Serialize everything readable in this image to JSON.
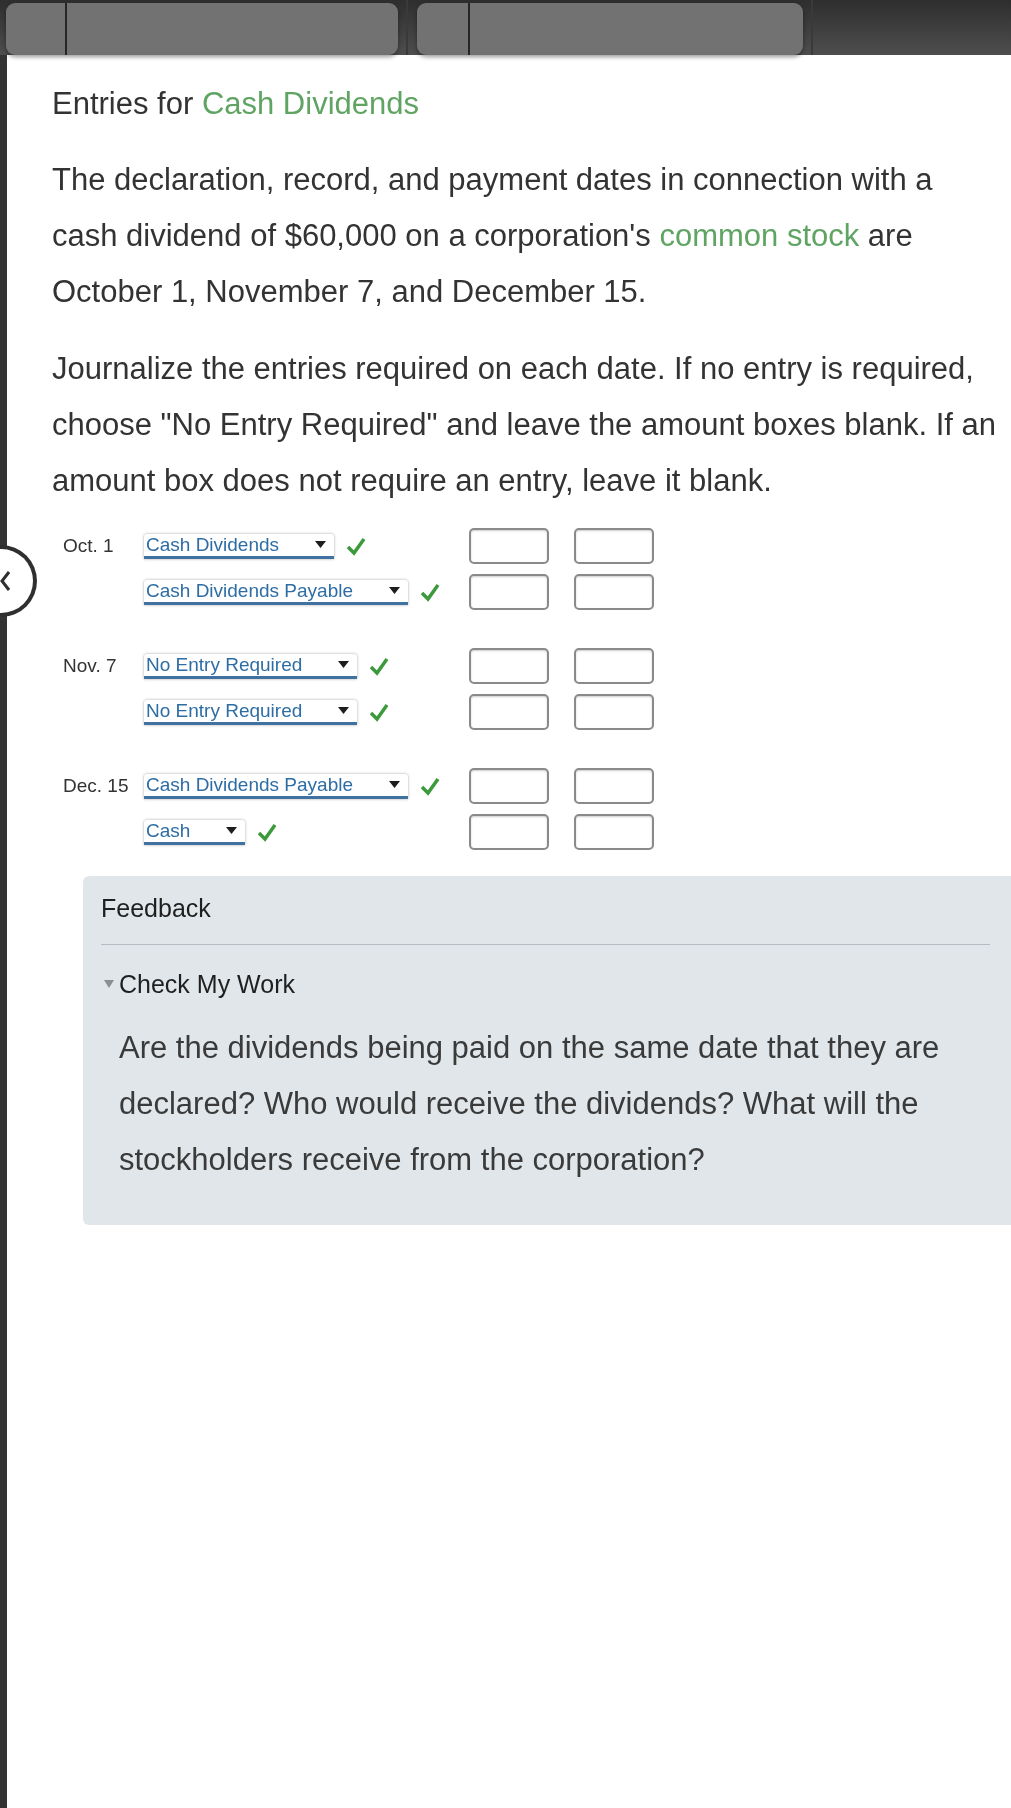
{
  "heading": {
    "prefix": "Entries for",
    "link": "Cash Dividends"
  },
  "problem": {
    "before": "The declaration, record, and payment dates in connection with a cash dividend of $60,000 on a corporation's",
    "link": "common stock",
    "after": "are October 1, November 7, and December 15."
  },
  "instructions": "Journalize the entries required on each date. If no entry is required, choose \"No Entry Required\" and leave the amount boxes blank. If an amount box does not require an entry, leave it blank.",
  "entries": [
    {
      "date": "Oct. 1",
      "lines": [
        {
          "account": "Cash Dividends",
          "correct": true
        },
        {
          "account": "Cash Dividends Payable",
          "correct": true
        }
      ]
    },
    {
      "date": "Nov. 7",
      "lines": [
        {
          "account": "No Entry Required",
          "correct": true
        },
        {
          "account": "No Entry Required",
          "correct": true
        }
      ]
    },
    {
      "date": "Dec. 15",
      "lines": [
        {
          "account": "Cash Dividends Payable",
          "correct": true
        },
        {
          "account": "Cash",
          "correct": true
        }
      ]
    }
  ],
  "feedback": {
    "heading": "Feedback",
    "sections": [
      {
        "title": "Check My Work",
        "expanded": true,
        "text": "Are the dividends being paid on the same date that they are declared? Who would receive the dividends? What will the stockholders receive from the corporation?"
      }
    ]
  }
}
